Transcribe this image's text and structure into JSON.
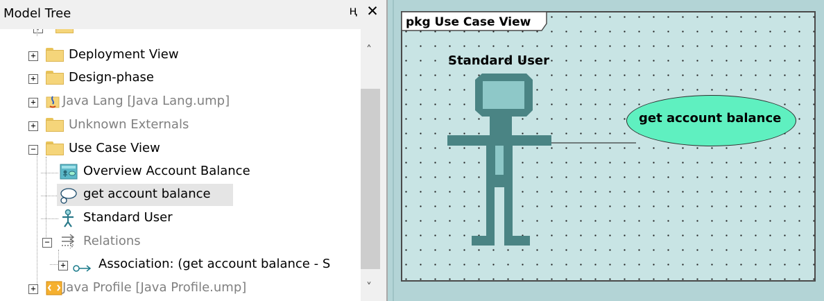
{
  "model_tree": {
    "title": "Model Tree",
    "pin_icon": "pin-icon",
    "close_icon": "close-icon",
    "items": [
      {
        "label": "Deployment View",
        "icon": "folder-icon",
        "expander": "+",
        "greyed": false
      },
      {
        "label": "Design-phase",
        "icon": "folder-icon",
        "expander": "+",
        "greyed": false
      },
      {
        "label": "Java Lang [Java Lang.ump]",
        "icon": "java-package-icon",
        "expander": "+",
        "greyed": true
      },
      {
        "label": "Unknown Externals",
        "icon": "folder-icon",
        "expander": "+",
        "greyed": true
      },
      {
        "label": "Use Case View",
        "icon": "folder-icon",
        "expander": "−",
        "greyed": false
      },
      {
        "label": "Overview Account Balance",
        "icon": "use-case-diagram-icon",
        "greyed": false
      },
      {
        "label": "get account balance",
        "icon": "use-case-icon",
        "greyed": false,
        "selected": true
      },
      {
        "label": "Standard User",
        "icon": "actor-icon",
        "greyed": false
      },
      {
        "label": "Relations",
        "icon": "relations-icon",
        "expander": "−",
        "greyed": true
      },
      {
        "label": "Association:  (get account balance - S",
        "icon": "association-icon",
        "expander": "+",
        "greyed": false
      },
      {
        "label": "Java Profile [Java Profile.ump]",
        "icon": "java-profile-icon",
        "expander": "+",
        "greyed": true
      }
    ]
  },
  "diagram": {
    "frame_label": "pkg Use Case View",
    "actor": {
      "name": "Standard User"
    },
    "use_case": {
      "name": "get account balance"
    },
    "colors": {
      "background": "#b3d4d6",
      "frame_fill": "#c8e4e4",
      "actor_stroke": "#4a8484",
      "actor_fill": "#8ec8c8",
      "use_case_fill": "#5ff0c0"
    }
  }
}
